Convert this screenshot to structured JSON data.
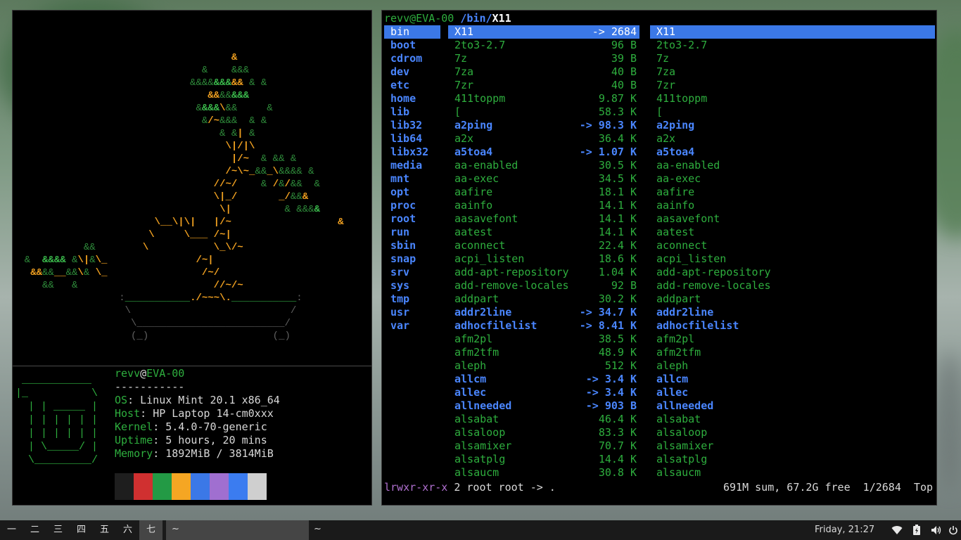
{
  "bonsai_art": "available",
  "neofetch": {
    "user_host": [
      "revv",
      "@",
      "EVA-00"
    ],
    "underline": "-----------",
    "lines": [
      {
        "key": "OS",
        "val": "Linux Mint 20.1 x86_64"
      },
      {
        "key": "Host",
        "val": "HP Laptop 14-cm0xxx"
      },
      {
        "key": "Kernel",
        "val": "5.4.0-70-generic"
      },
      {
        "key": "Uptime",
        "val": "5 hours, 20 mins"
      },
      {
        "key": "Memory",
        "val": "1892MiB / 3814MiB"
      }
    ],
    "swatches": [
      "#1e1e1e",
      "#d03030",
      "#239a45",
      "#f5a623",
      "#3b78e7",
      "#a06fd0",
      "#3b7cf0",
      "#cfcfcf"
    ]
  },
  "ranger": {
    "title_userhost": "revv@EVA-00",
    "title_path": "/bin/",
    "title_file": "X11",
    "parent_dirs": [
      "bin",
      "boot",
      "cdrom",
      "dev",
      "etc",
      "home",
      "lib",
      "lib32",
      "lib64",
      "libx32",
      "media",
      "mnt",
      "opt",
      "proc",
      "root",
      "run",
      "sbin",
      "snap",
      "srv",
      "sys",
      "tmp",
      "usr",
      "var"
    ],
    "files": [
      {
        "name": "X11",
        "size": "-> 2684",
        "type": "sel"
      },
      {
        "name": "2to3-2.7",
        "size": "96 B",
        "type": "exe"
      },
      {
        "name": "7z",
        "size": "39 B",
        "type": "exe"
      },
      {
        "name": "7za",
        "size": "40 B",
        "type": "exe"
      },
      {
        "name": "7zr",
        "size": "40 B",
        "type": "exe"
      },
      {
        "name": "411toppm",
        "size": "9.87 K",
        "type": "exe"
      },
      {
        "name": "[",
        "size": "58.3 K",
        "type": "exe"
      },
      {
        "name": "a2ping",
        "size": "-> 98.3 K",
        "type": "lnk"
      },
      {
        "name": "a2x",
        "size": "36.4 K",
        "type": "exe"
      },
      {
        "name": "a5toa4",
        "size": "-> 1.07 K",
        "type": "lnk"
      },
      {
        "name": "aa-enabled",
        "size": "30.5 K",
        "type": "exe"
      },
      {
        "name": "aa-exec",
        "size": "34.5 K",
        "type": "exe"
      },
      {
        "name": "aafire",
        "size": "18.1 K",
        "type": "exe"
      },
      {
        "name": "aainfo",
        "size": "14.1 K",
        "type": "exe"
      },
      {
        "name": "aasavefont",
        "size": "14.1 K",
        "type": "exe"
      },
      {
        "name": "aatest",
        "size": "14.1 K",
        "type": "exe"
      },
      {
        "name": "aconnect",
        "size": "22.4 K",
        "type": "exe"
      },
      {
        "name": "acpi_listen",
        "size": "18.6 K",
        "type": "exe"
      },
      {
        "name": "add-apt-repository",
        "size": "1.04 K",
        "type": "exe"
      },
      {
        "name": "add-remove-locales",
        "size": "92 B",
        "type": "exe"
      },
      {
        "name": "addpart",
        "size": "30.2 K",
        "type": "exe"
      },
      {
        "name": "addr2line",
        "size": "-> 34.7 K",
        "type": "lnk"
      },
      {
        "name": "adhocfilelist",
        "size": "-> 8.41 K",
        "type": "lnk"
      },
      {
        "name": "afm2pl",
        "size": "38.5 K",
        "type": "exe"
      },
      {
        "name": "afm2tfm",
        "size": "48.9 K",
        "type": "exe"
      },
      {
        "name": "aleph",
        "size": "512 K",
        "type": "exe"
      },
      {
        "name": "allcm",
        "size": "-> 3.4 K",
        "type": "lnk"
      },
      {
        "name": "allec",
        "size": "-> 3.4 K",
        "type": "lnk"
      },
      {
        "name": "allneeded",
        "size": "-> 903 B",
        "type": "lnk"
      },
      {
        "name": "alsabat",
        "size": "46.4 K",
        "type": "exe"
      },
      {
        "name": "alsaloop",
        "size": "83.3 K",
        "type": "exe"
      },
      {
        "name": "alsamixer",
        "size": "70.7 K",
        "type": "exe"
      },
      {
        "name": "alsatplg",
        "size": "14.4 K",
        "type": "exe"
      },
      {
        "name": "alsaucm",
        "size": "30.8 K",
        "type": "exe"
      }
    ],
    "status_perm": "lrwxr-xr-x",
    "status_rest": " 2 root root -> .",
    "status_right": "691M sum, 67.2G free  1/2684  Top"
  },
  "taskbar": {
    "workspaces": [
      "一",
      "二",
      "三",
      "四",
      "五",
      "六",
      "七"
    ],
    "active_workspace": 6,
    "task1": "~",
    "task2": "~",
    "clock": "Friday, 21:27",
    "tray": [
      "wifi-icon",
      "battery-icon",
      "volume-icon",
      "power-icon"
    ]
  }
}
